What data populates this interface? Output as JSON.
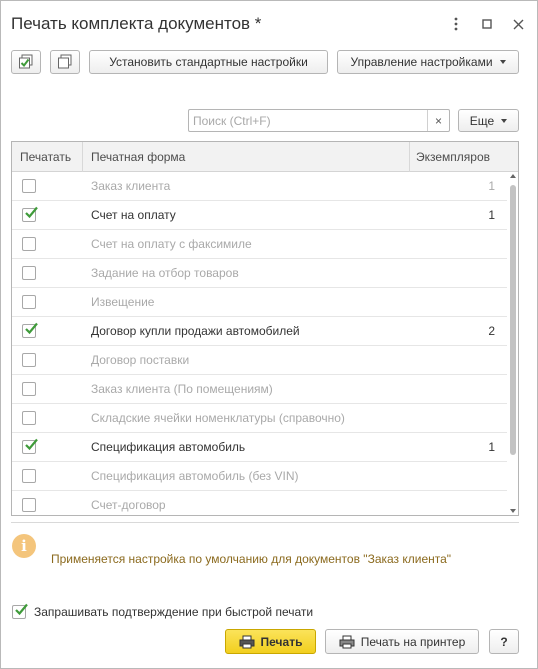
{
  "window": {
    "title": "Печать комплекта документов *"
  },
  "toolbar": {
    "set_default_label": "Установить стандартные настройки",
    "manage_settings_label": "Управление настройками"
  },
  "search": {
    "placeholder": "Поиск (Ctrl+F)",
    "clear_symbol": "×",
    "more_label": "Еще"
  },
  "table": {
    "columns": [
      "Печатать",
      "Печатная форма",
      "Экземпляров"
    ],
    "rows": [
      {
        "checked": false,
        "name": "Заказ клиента",
        "copies": "1"
      },
      {
        "checked": true,
        "name": "Счет на оплату",
        "copies": "1"
      },
      {
        "checked": false,
        "name": "Счет на оплату с факсимиле",
        "copies": ""
      },
      {
        "checked": false,
        "name": "Задание на отбор товаров",
        "copies": ""
      },
      {
        "checked": false,
        "name": "Извещение",
        "copies": ""
      },
      {
        "checked": true,
        "name": "Договор купли продажи автомобилей",
        "copies": "2"
      },
      {
        "checked": false,
        "name": "Договор поставки",
        "copies": ""
      },
      {
        "checked": false,
        "name": "Заказ клиента (По помещениям)",
        "copies": ""
      },
      {
        "checked": false,
        "name": "Складские ячейки номенклатуры (справочно)",
        "copies": ""
      },
      {
        "checked": true,
        "name": "Спецификация автомобиль",
        "copies": "1"
      },
      {
        "checked": false,
        "name": "Спецификация автомобиль (без VIN)",
        "copies": ""
      },
      {
        "checked": false,
        "name": "Счет-договор",
        "copies": ""
      }
    ]
  },
  "info": {
    "icon_symbol": "i",
    "text": "Применяется настройка по умолчанию для документов \"Заказ клиента\""
  },
  "confirm": {
    "checked": true,
    "label": "Запрашивать подтверждение при быстрой печати"
  },
  "footer": {
    "print_label": "Печать",
    "print_to_printer_label": "Печать на принтер",
    "help_label": "?"
  },
  "colors": {
    "accent_yellow": "#f6d832",
    "check_green": "#3f9b3a",
    "info_orange": "#f4c57c",
    "info_text": "#8b6a1e"
  }
}
